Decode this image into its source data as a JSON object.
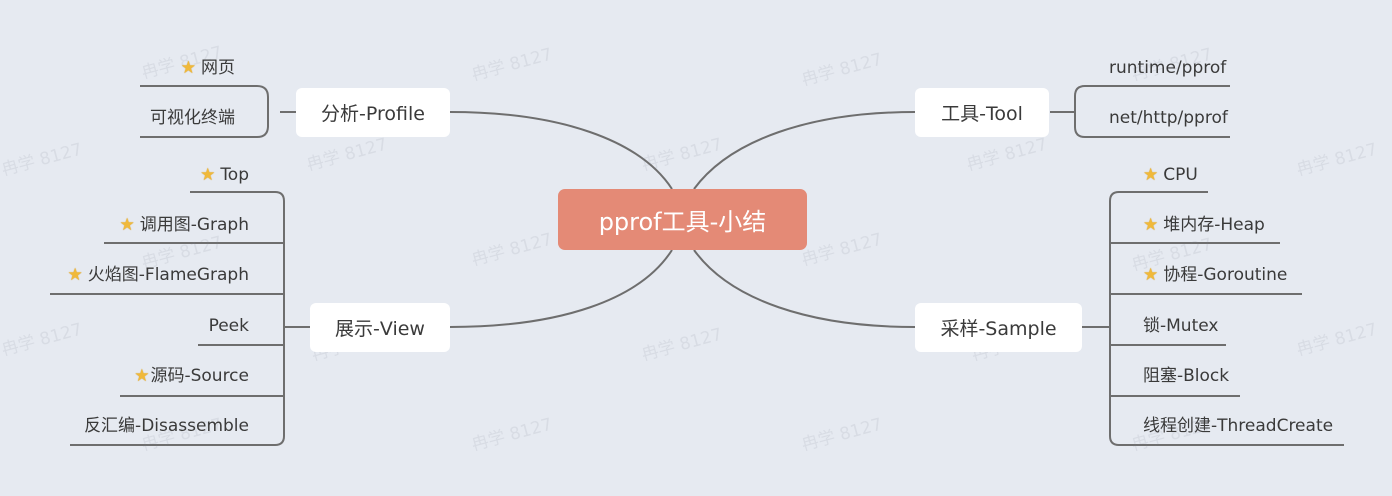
{
  "central": {
    "label": "pprof工具-小结"
  },
  "branches": {
    "profile": {
      "label": "分析-Profile",
      "leaves": [
        {
          "label": "网页",
          "star": true
        },
        {
          "label": "可视化终端",
          "star": false
        }
      ]
    },
    "view": {
      "label": "展示-View",
      "leaves": [
        {
          "label": "Top",
          "star": true
        },
        {
          "label": "调用图-Graph",
          "star": true
        },
        {
          "label": "火焰图-FlameGraph",
          "star": true
        },
        {
          "label": "Peek",
          "star": false
        },
        {
          "label": "源码-Source",
          "star": true
        },
        {
          "label": "反汇编-Disassemble",
          "star": false
        }
      ]
    },
    "tool": {
      "label": "工具-Tool",
      "leaves": [
        {
          "label": "runtime/pprof",
          "star": false
        },
        {
          "label": "net/http/pprof",
          "star": false
        }
      ]
    },
    "sample": {
      "label": "采样-Sample",
      "leaves": [
        {
          "label": "CPU",
          "star": true
        },
        {
          "label": "堆内存-Heap",
          "star": true
        },
        {
          "label": "协程-Goroutine",
          "star": true
        },
        {
          "label": "锁-Mutex",
          "star": false
        },
        {
          "label": "阻塞-Block",
          "star": false
        },
        {
          "label": "线程创建-ThreadCreate",
          "star": false
        }
      ]
    }
  },
  "icons": {
    "star": "star-icon"
  },
  "colors": {
    "background": "#e6eaf1",
    "central": "#e48a76",
    "line": "#6e6e6e",
    "star": "#f0b93a"
  },
  "watermark": "冉学 8127"
}
